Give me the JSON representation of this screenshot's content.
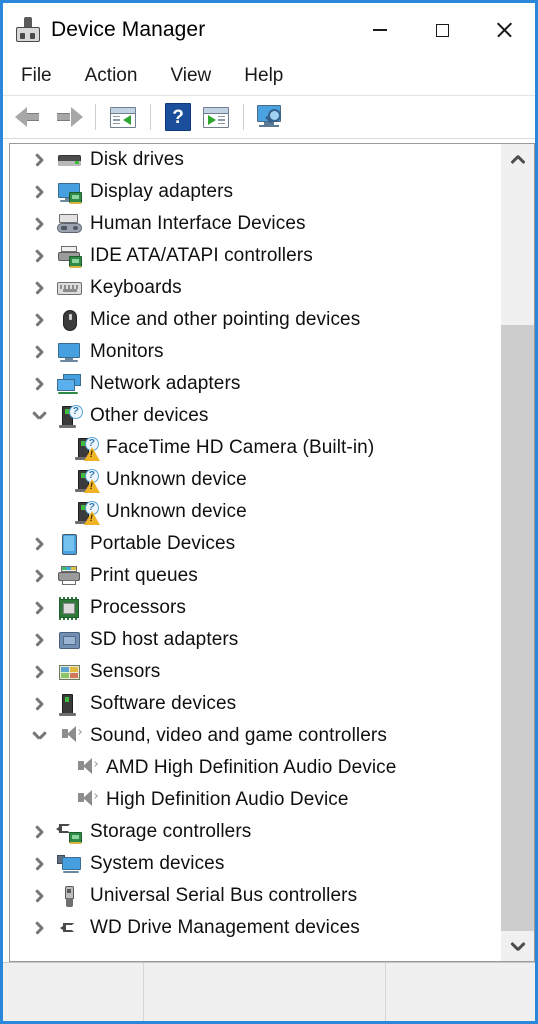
{
  "window": {
    "title": "Device Manager",
    "icon": "device-manager-icon",
    "accent_color": "#2b88d8",
    "controls": [
      {
        "name": "minimize",
        "glyph": "minimize-icon"
      },
      {
        "name": "maximize",
        "glyph": "maximize-icon"
      },
      {
        "name": "close",
        "glyph": "close-icon"
      }
    ]
  },
  "menubar": {
    "items": [
      {
        "label": "File"
      },
      {
        "label": "Action"
      },
      {
        "label": "View"
      },
      {
        "label": "Help"
      }
    ]
  },
  "toolbar": {
    "buttons": [
      {
        "name": "back-button",
        "icon": "back-arrow-icon"
      },
      {
        "name": "forward-button",
        "icon": "forward-arrow-icon"
      },
      {
        "name": "show-hide-console-tree-button",
        "icon": "console-tree-icon"
      },
      {
        "name": "help-button",
        "icon": "help-question-icon",
        "glyph": "?"
      },
      {
        "name": "properties-button",
        "icon": "properties-icon"
      },
      {
        "name": "scan-for-hardware-changes-button",
        "icon": "scan-hardware-icon"
      }
    ]
  },
  "tree": {
    "rows": [
      {
        "label": "Disk drives",
        "level": 0,
        "state": "collapsed",
        "icon": "disk-drive-icon"
      },
      {
        "label": "Display adapters",
        "level": 0,
        "state": "collapsed",
        "icon": "display-adapter-icon"
      },
      {
        "label": "Human Interface Devices",
        "level": 0,
        "state": "collapsed",
        "icon": "hid-icon"
      },
      {
        "label": "IDE ATA/ATAPI controllers",
        "level": 0,
        "state": "collapsed",
        "icon": "ide-controller-icon"
      },
      {
        "label": "Keyboards",
        "level": 0,
        "state": "collapsed",
        "icon": "keyboard-icon"
      },
      {
        "label": "Mice and other pointing devices",
        "level": 0,
        "state": "collapsed",
        "icon": "mouse-icon"
      },
      {
        "label": "Monitors",
        "level": 0,
        "state": "collapsed",
        "icon": "monitor-icon"
      },
      {
        "label": "Network adapters",
        "level": 0,
        "state": "collapsed",
        "icon": "network-adapter-icon"
      },
      {
        "label": "Other devices",
        "level": 0,
        "state": "expanded",
        "icon": "unknown-device-icon"
      },
      {
        "label": "FaceTime HD Camera (Built-in)",
        "level": 1,
        "state": "leaf",
        "icon": "unknown-device-warning-icon"
      },
      {
        "label": "Unknown device",
        "level": 1,
        "state": "leaf",
        "icon": "unknown-device-warning-icon"
      },
      {
        "label": "Unknown device",
        "level": 1,
        "state": "leaf",
        "icon": "unknown-device-warning-icon"
      },
      {
        "label": "Portable Devices",
        "level": 0,
        "state": "collapsed",
        "icon": "portable-device-icon"
      },
      {
        "label": "Print queues",
        "level": 0,
        "state": "collapsed",
        "icon": "printer-icon"
      },
      {
        "label": "Processors",
        "level": 0,
        "state": "collapsed",
        "icon": "processor-icon"
      },
      {
        "label": "SD host adapters",
        "level": 0,
        "state": "collapsed",
        "icon": "sd-host-adapter-icon"
      },
      {
        "label": "Sensors",
        "level": 0,
        "state": "collapsed",
        "icon": "sensor-icon"
      },
      {
        "label": "Software devices",
        "level": 0,
        "state": "collapsed",
        "icon": "software-device-icon"
      },
      {
        "label": "Sound, video and game controllers",
        "level": 0,
        "state": "expanded",
        "icon": "speaker-icon"
      },
      {
        "label": "AMD High Definition Audio Device",
        "level": 1,
        "state": "leaf",
        "icon": "speaker-icon"
      },
      {
        "label": "High Definition Audio Device",
        "level": 1,
        "state": "leaf",
        "icon": "speaker-icon"
      },
      {
        "label": "Storage controllers",
        "level": 0,
        "state": "collapsed",
        "icon": "storage-controller-icon"
      },
      {
        "label": "System devices",
        "level": 0,
        "state": "collapsed",
        "icon": "system-device-icon"
      },
      {
        "label": "Universal Serial Bus controllers",
        "level": 0,
        "state": "collapsed",
        "icon": "usb-controller-icon"
      },
      {
        "label": "WD Drive Management devices",
        "level": 0,
        "state": "collapsed",
        "icon": "wd-drive-management-icon"
      }
    ]
  },
  "scrollbar": {
    "up_button": "scroll-up-icon",
    "down_button": "scroll-down-icon",
    "thumb_top_percent": 0,
    "thumb_height_percent": 20
  },
  "statusbar": {
    "pane1": "",
    "pane2": "",
    "pane3": ""
  }
}
